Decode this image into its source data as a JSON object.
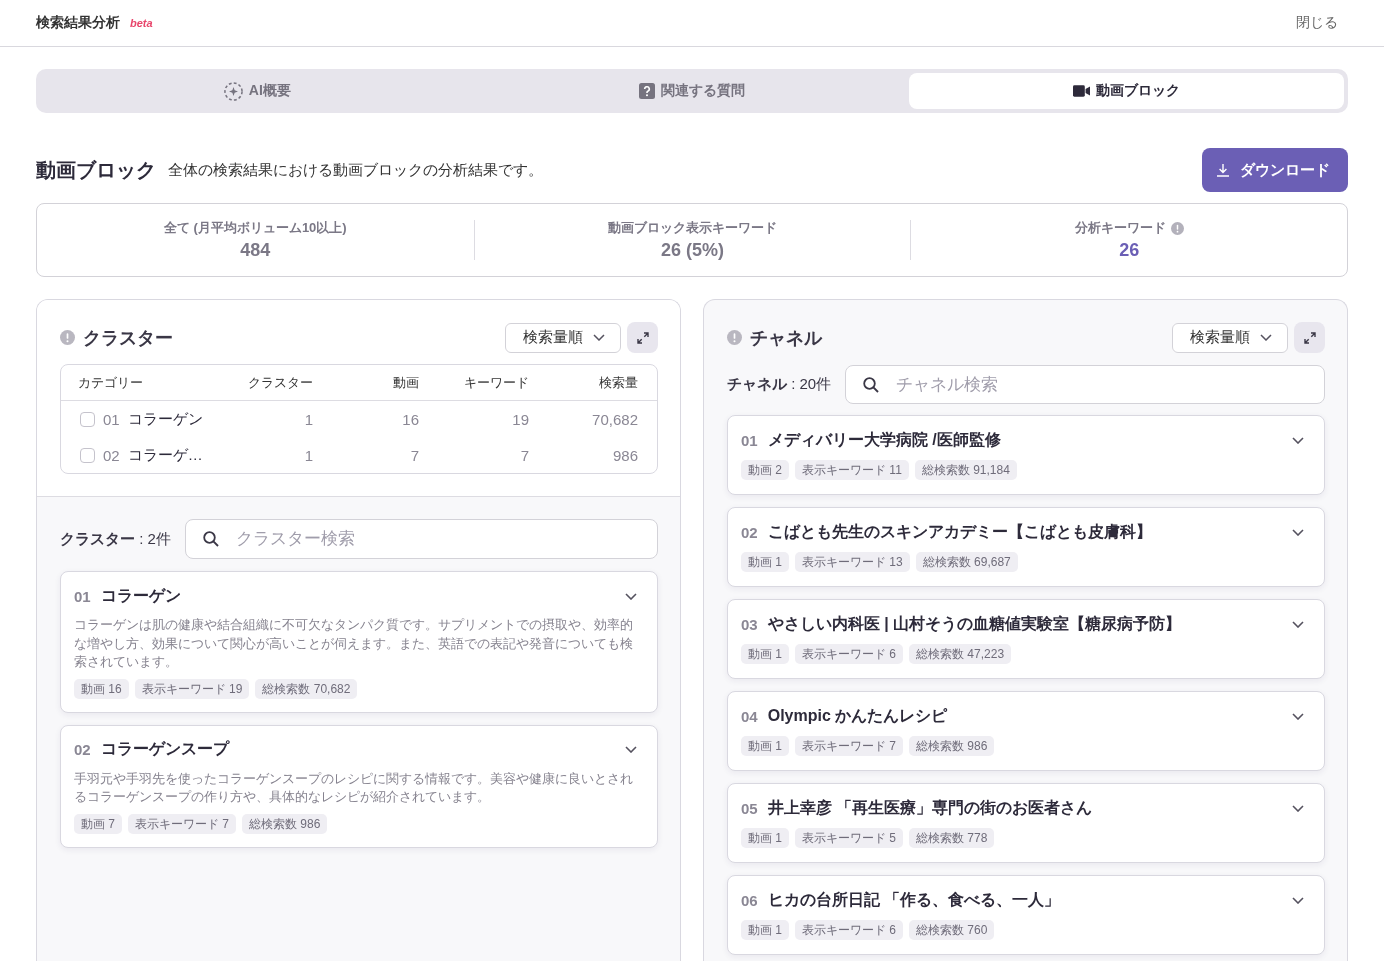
{
  "header": {
    "title": "検索結果分析",
    "badge": "beta",
    "close": "閉じる"
  },
  "tabs": [
    {
      "label": "AI概要",
      "kind": "overview",
      "selected": false
    },
    {
      "label": "関連する質問",
      "kind": "questions",
      "selected": false
    },
    {
      "label": "動画ブロック",
      "kind": "video",
      "selected": true
    }
  ],
  "section": {
    "title": "動画ブロック",
    "description": "全体の検索結果における動画ブロックの分析結果です。",
    "download": "ダウンロード"
  },
  "stats": [
    {
      "label": "全て (月平均ボリューム10以上)",
      "value": "484",
      "highlight": false,
      "info": false
    },
    {
      "label": "動画ブロック表示キーワード",
      "value": "26 (5%)",
      "highlight": false,
      "info": false
    },
    {
      "label": "分析キーワード",
      "value": "26",
      "highlight": true,
      "info": true
    }
  ],
  "cluster_panel": {
    "title": "クラスター",
    "sort": "検索量順",
    "table": {
      "columns": [
        "カテゴリー",
        "クラスター",
        "動画",
        "キーワード",
        "検索量"
      ],
      "rows": [
        {
          "checked": false,
          "number": "01",
          "name": "コラーゲン",
          "clusters": "1",
          "videos": "16",
          "keywords": "19",
          "volume": "70,682"
        },
        {
          "checked": false,
          "number": "02",
          "name": "コラーゲ…",
          "clusters": "1",
          "videos": "7",
          "keywords": "7",
          "volume": "986"
        }
      ]
    },
    "count_label": "**クラスター** : 2件",
    "search": {
      "placeholder": "クラスター検索"
    },
    "cards": [
      {
        "number": "01",
        "title": "コラーゲン",
        "description": "コラーゲンは肌の健康や結合組織に不可欠なタンパク質です。サプリメントでの摂取や、効率的な増やし方、効果について関心が高いことが伺えます。また、英語での表記や発音についても検索されています。",
        "tags": [
          "動画 16",
          "表示キーワード 19",
          "総検索数 70,682"
        ]
      },
      {
        "number": "02",
        "title": "コラーゲンスープ",
        "description": "手羽元や手羽先を使ったコラーゲンスープのレシピに関する情報です。美容や健康に良いとされるコラーゲンスープの作り方や、具体的なレシピが紹介されています。",
        "tags": [
          "動画 7",
          "表示キーワード 7",
          "総検索数 986"
        ]
      }
    ]
  },
  "channel_panel": {
    "title": "チャネル",
    "sort": "検索量順",
    "count_label": "**チャネル** : 20件",
    "search": {
      "placeholder": "チャネル検索"
    },
    "cards": [
      {
        "number": "01",
        "title": "メディバリー大学病院 /医師監修",
        "tags": [
          "動画 2",
          "表示キーワード 11",
          "総検索数 91,184"
        ]
      },
      {
        "number": "02",
        "title": "こばとも先生のスキンアカデミー【こばとも皮膚科】",
        "tags": [
          "動画 1",
          "表示キーワード 13",
          "総検索数 69,687"
        ]
      },
      {
        "number": "03",
        "title": "やさしい内科医 | 山村そうの血糖値実験室【糖尿病予防】",
        "tags": [
          "動画 1",
          "表示キーワード 6",
          "総検索数 47,223"
        ]
      },
      {
        "number": "04",
        "title": "Olympic かんたんレシピ",
        "tags": [
          "動画 1",
          "表示キーワード 7",
          "総検索数 986"
        ]
      },
      {
        "number": "05",
        "title": "井上幸彦 「再生医療」専門の街のお医者さん",
        "tags": [
          "動画 1",
          "表示キーワード 5",
          "総検索数 778"
        ]
      },
      {
        "number": "06",
        "title": "ヒカの台所日記 「作る、食べる、一人」",
        "tags": [
          "動画 1",
          "表示キーワード 6",
          "総検索数 760"
        ]
      }
    ]
  }
}
